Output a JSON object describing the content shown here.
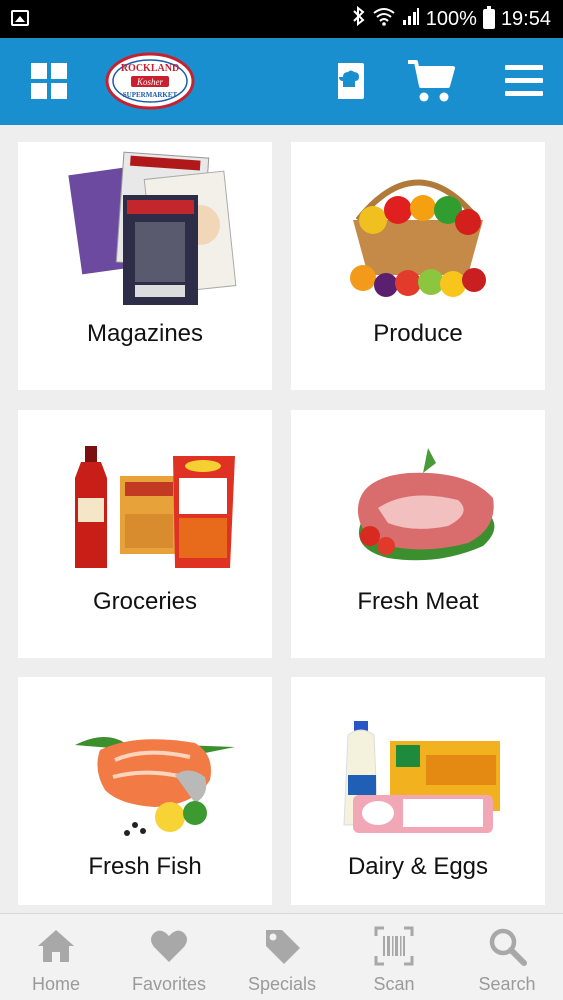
{
  "status_bar": {
    "battery_percent": "100%",
    "time": "19:54"
  },
  "header": {
    "logo_top": "ROCKLAND",
    "logo_middle": "Kosher",
    "logo_bottom": "SUPERMARKET"
  },
  "categories": [
    {
      "label": "Magazines"
    },
    {
      "label": "Produce"
    },
    {
      "label": "Groceries"
    },
    {
      "label": "Fresh Meat"
    },
    {
      "label": "Fresh Fish"
    },
    {
      "label": "Dairy & Eggs"
    }
  ],
  "bottom_nav": [
    {
      "label": "Home",
      "icon": "home-icon"
    },
    {
      "label": "Favorites",
      "icon": "heart-icon"
    },
    {
      "label": "Specials",
      "icon": "tag-icon"
    },
    {
      "label": "Scan",
      "icon": "barcode-icon"
    },
    {
      "label": "Search",
      "icon": "search-icon"
    }
  ],
  "colors": {
    "header": "#1a8fd0",
    "background": "#eeeeee",
    "tile": "#ffffff",
    "nav_icon": "#a8a8a8"
  }
}
